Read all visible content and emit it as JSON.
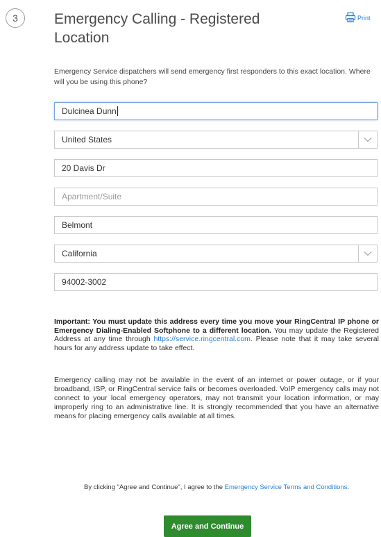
{
  "step": {
    "number": "3"
  },
  "header": {
    "title": "Emergency Calling - Registered Location",
    "print_label": "Print"
  },
  "intro_text": "Emergency Service dispatchers will send emergency first responders to this exact location. Where will you be using this phone?",
  "form": {
    "name": {
      "value": "Dulcinea Dunn"
    },
    "country": {
      "value": "United States"
    },
    "street": {
      "value": "20 Davis Dr"
    },
    "apartment": {
      "value": "",
      "placeholder": "Apartment/Suite"
    },
    "city": {
      "value": "Belmont"
    },
    "state": {
      "value": "California"
    },
    "zip": {
      "value": "94002-3002"
    }
  },
  "important": {
    "bold_text": "Important: You must update this address every time you move your RingCentral IP phone or Emergency Dialing-Enabled Softphone to a different location.",
    "text_before_link": "You may update the Registered Address at any time through ",
    "link": "https://service.ringcentral.com",
    "text_after_link": ". Please note that it may take several hours for any address update to take effect."
  },
  "disclaimer": "Emergency calling may not be available in the event of an internet or power outage, or if your broadband, ISP, or RingCentral service fails or becomes overloaded. VoIP emergency calls may not connect to your local emergency operators, may not transmit your location information, or may improperly ring to an administrative line. It is strongly recommended that you have an alternative means for placing emergency calls available at all times.",
  "consent": {
    "prefix": "By clicking \"Agree and Continue\", I agree to the ",
    "link": "Emergency Service Terms and Conditions",
    "suffix": "."
  },
  "actions": {
    "agree_label": "Agree and Continue"
  },
  "colors": {
    "accent": "#2a7fd4",
    "button": "#2e8b2e"
  }
}
